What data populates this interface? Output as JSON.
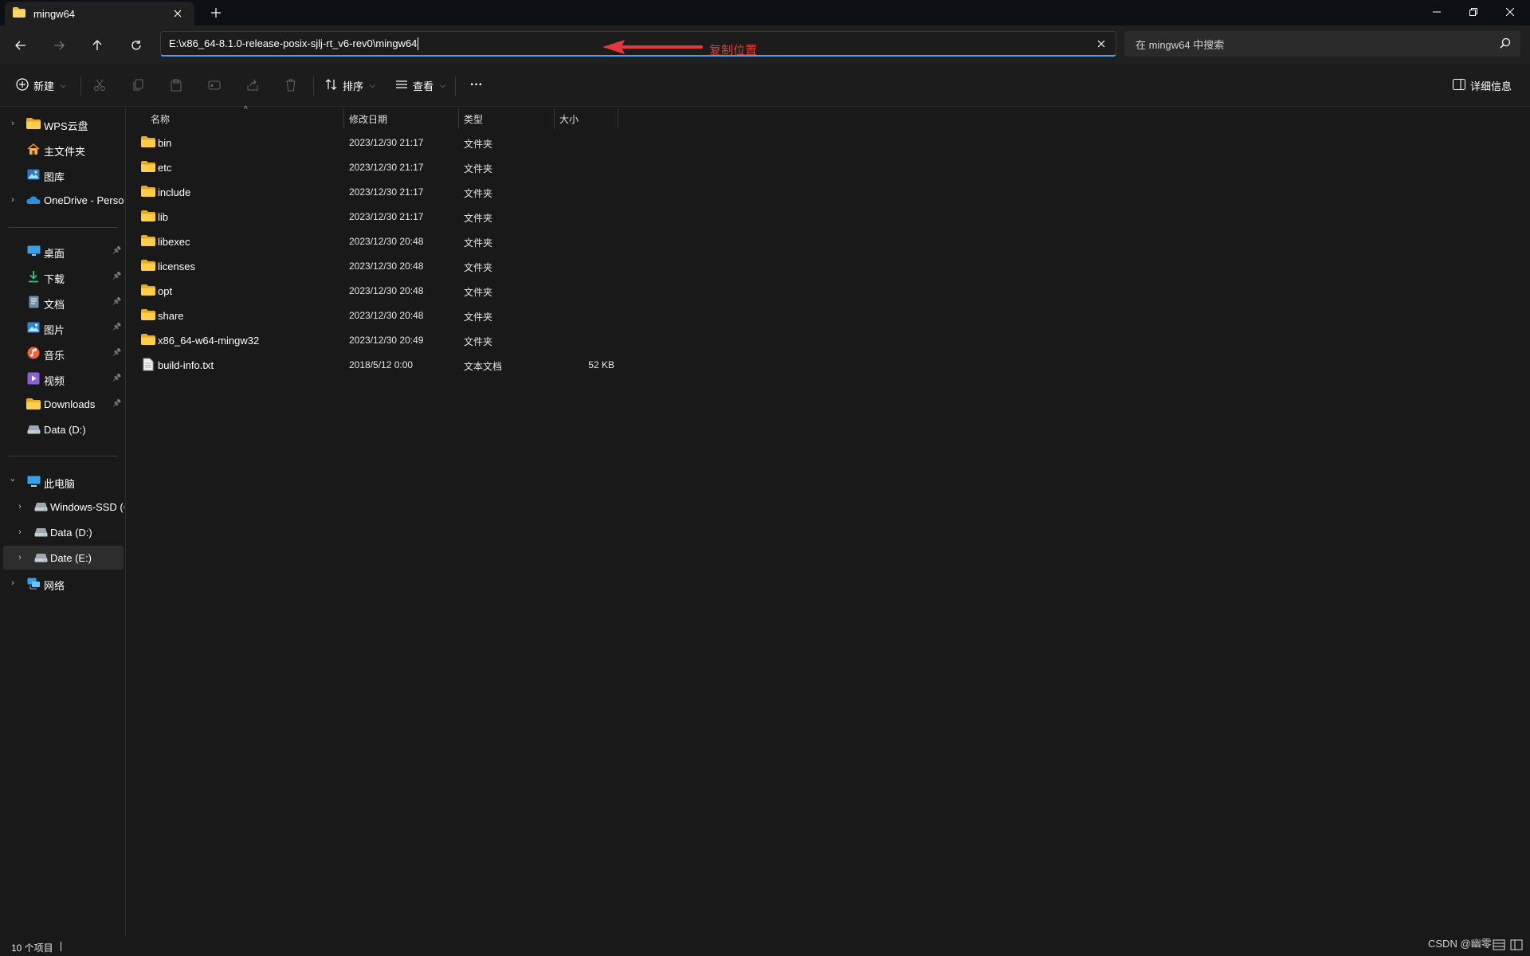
{
  "window": {
    "tab_title": "mingw64",
    "new_tab_icon": "plus-icon",
    "controls": [
      "minimize-icon",
      "restore-icon",
      "close-icon"
    ]
  },
  "nav": {
    "address": "E:\\x86_64-8.1.0-release-posix-sjlj-rt_v6-rev0\\mingw64",
    "annotation": "复制位置",
    "annotation_color": "#e23a3a",
    "search_placeholder": "在 mingw64 中搜索"
  },
  "toolbar": {
    "new_label": "新建",
    "sort_label": "排序",
    "view_label": "查看",
    "details_label": "详细信息",
    "more_label": "···"
  },
  "sidebar": {
    "quick": [
      {
        "label": "WPS云盘",
        "icon": "folder-icon"
      },
      {
        "label": "主文件夹",
        "icon": "home-icon"
      },
      {
        "label": "图库",
        "icon": "gallery-icon"
      },
      {
        "label": "OneDrive - Perso",
        "icon": "cloud-icon"
      }
    ],
    "pinned": [
      {
        "label": "桌面",
        "icon": "desktop-icon"
      },
      {
        "label": "下载",
        "icon": "download-icon"
      },
      {
        "label": "文档",
        "icon": "document-icon"
      },
      {
        "label": "图片",
        "icon": "picture-icon"
      },
      {
        "label": "音乐",
        "icon": "music-icon"
      },
      {
        "label": "视频",
        "icon": "video-icon"
      },
      {
        "label": "Downloads",
        "icon": "folder-icon"
      },
      {
        "label": "Data (D:)",
        "icon": "drive-icon"
      }
    ],
    "pc": {
      "label": "此电脑",
      "icon": "computer-icon"
    },
    "drives": [
      {
        "label": "Windows-SSD (C",
        "icon": "drive-icon"
      },
      {
        "label": "Data (D:)",
        "icon": "drive-icon"
      },
      {
        "label": "Date (E:)",
        "icon": "drive-icon"
      }
    ],
    "network": {
      "label": "网络",
      "icon": "network-icon"
    }
  },
  "columns": {
    "name": "名称",
    "modified": "修改日期",
    "type": "类型",
    "size": "大小"
  },
  "files": [
    {
      "name": "bin",
      "modified": "2023/12/30 21:17",
      "type": "文件夹",
      "size": "",
      "icon": "folder-icon"
    },
    {
      "name": "etc",
      "modified": "2023/12/30 21:17",
      "type": "文件夹",
      "size": "",
      "icon": "folder-icon"
    },
    {
      "name": "include",
      "modified": "2023/12/30 21:17",
      "type": "文件夹",
      "size": "",
      "icon": "folder-icon"
    },
    {
      "name": "lib",
      "modified": "2023/12/30 21:17",
      "type": "文件夹",
      "size": "",
      "icon": "folder-icon"
    },
    {
      "name": "libexec",
      "modified": "2023/12/30 20:48",
      "type": "文件夹",
      "size": "",
      "icon": "folder-icon"
    },
    {
      "name": "licenses",
      "modified": "2023/12/30 20:48",
      "type": "文件夹",
      "size": "",
      "icon": "folder-icon"
    },
    {
      "name": "opt",
      "modified": "2023/12/30 20:48",
      "type": "文件夹",
      "size": "",
      "icon": "folder-icon"
    },
    {
      "name": "share",
      "modified": "2023/12/30 20:48",
      "type": "文件夹",
      "size": "",
      "icon": "folder-icon"
    },
    {
      "name": "x86_64-w64-mingw32",
      "modified": "2023/12/30 20:49",
      "type": "文件夹",
      "size": "",
      "icon": "folder-icon"
    },
    {
      "name": "build-info.txt",
      "modified": "2018/5/12 0:00",
      "type": "文本文档",
      "size": "52 KB",
      "icon": "text-file-icon"
    }
  ],
  "status": {
    "count": "10 个项目"
  },
  "watermark": "CSDN @幽零"
}
